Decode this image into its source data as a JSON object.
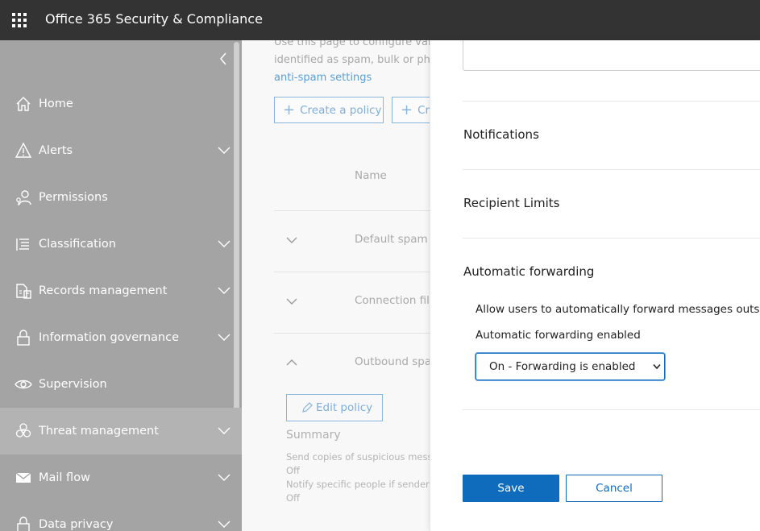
{
  "app": {
    "title": "Office 365 Security & Compliance"
  },
  "sidebar": {
    "items": [
      {
        "label": "Home",
        "icon": "home-icon",
        "expandable": false
      },
      {
        "label": "Alerts",
        "icon": "alert-icon",
        "expandable": true
      },
      {
        "label": "Permissions",
        "icon": "permissions-icon",
        "expandable": false
      },
      {
        "label": "Classification",
        "icon": "classification-icon",
        "expandable": true
      },
      {
        "label": "Records management",
        "icon": "records-icon",
        "expandable": true
      },
      {
        "label": "Information governance",
        "icon": "lock-icon",
        "expandable": true
      },
      {
        "label": "Supervision",
        "icon": "eye-icon",
        "expandable": false
      },
      {
        "label": "Threat management",
        "icon": "biohazard-icon",
        "expandable": true,
        "selected": true
      },
      {
        "label": "Mail flow",
        "icon": "mail-icon",
        "expandable": true
      },
      {
        "label": "Data privacy",
        "icon": "lock-icon",
        "expandable": true
      }
    ]
  },
  "background": {
    "intro_line1": "Use this page to configure vario",
    "intro_line2": "identified as spam, bulk or phis",
    "intro_link": "anti-spam settings",
    "create_policy": "Create a policy",
    "create_other": "Cr",
    "column_name": "Name",
    "rows": [
      {
        "label": "Default spam fi"
      },
      {
        "label": "Connection filte"
      },
      {
        "label": "Outbound spar"
      }
    ],
    "edit_policy": "Edit policy",
    "summary": "Summary",
    "summary_line1": "Send copies of suspicious messag",
    "summary_val1": "Off",
    "summary_line2": "Notify specific people if senders a",
    "summary_val2": "Off"
  },
  "panel": {
    "notifications": "Notifications",
    "recipient_limits": "Recipient Limits",
    "auto_forwarding": "Automatic forwarding",
    "allow_text": "Allow users to automatically forward messages outside th",
    "enabled_label": "Automatic forwarding enabled",
    "select_value": "On - Forwarding is enabled",
    "save": "Save",
    "cancel": "Cancel"
  }
}
